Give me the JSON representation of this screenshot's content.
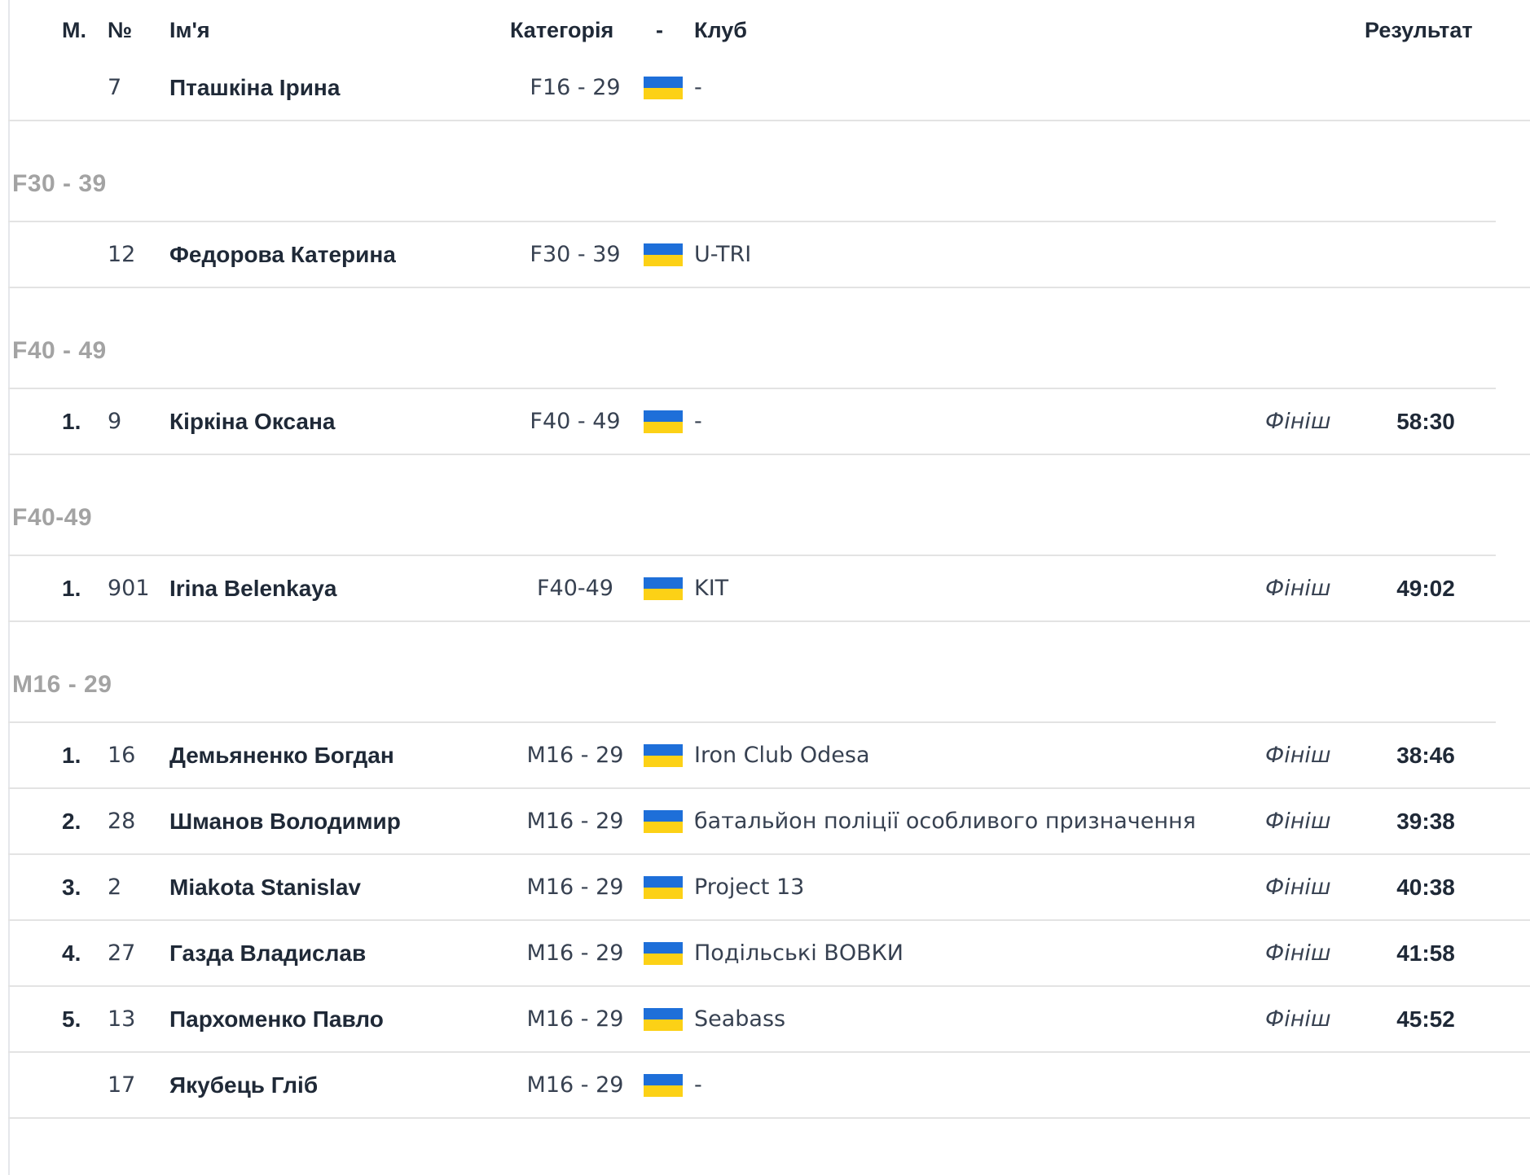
{
  "header": {
    "place": "М.",
    "number": "№",
    "name": "Ім'я",
    "category": "Категорія",
    "separator": "-",
    "club": "Клуб",
    "result": "Результат"
  },
  "colors": {
    "flag_blue": "#1e6fd9",
    "flag_yellow": "#fcd116",
    "group_title": "#a3a3a3"
  },
  "top_row": {
    "place": "",
    "number": "7",
    "name": "Пташкіна Ірина",
    "category": "F16 - 29",
    "flag": "ukraine-flag-icon",
    "club": "-",
    "status": "",
    "time": ""
  },
  "groups": [
    {
      "title": "F30 - 39",
      "rows": [
        {
          "place": "",
          "number": "12",
          "name": "Федорова Катерина",
          "category": "F30 - 39",
          "flag": "ukraine-flag-icon",
          "club": "U-TRI",
          "status": "",
          "time": ""
        }
      ]
    },
    {
      "title": "F40 - 49",
      "rows": [
        {
          "place": "1.",
          "number": "9",
          "name": "Кіркіна Оксана",
          "category": "F40 - 49",
          "flag": "ukraine-flag-icon",
          "club": "-",
          "status": "Фініш",
          "time": "58:30"
        }
      ]
    },
    {
      "title": "F40-49",
      "rows": [
        {
          "place": "1.",
          "number": "901",
          "name": "Irina Belenkaya",
          "category": "F40-49",
          "flag": "ukraine-flag-icon",
          "club": "KIT",
          "status": "Фініш",
          "time": "49:02"
        }
      ]
    },
    {
      "title": "M16 - 29",
      "rows": [
        {
          "place": "1.",
          "number": "16",
          "name": "Демьяненко Богдан",
          "category": "M16 - 29",
          "flag": "ukraine-flag-icon",
          "club": "Iron Club Odesa",
          "status": "Фініш",
          "time": "38:46"
        },
        {
          "place": "2.",
          "number": "28",
          "name": "Шманов Володимир",
          "category": "M16 - 29",
          "flag": "ukraine-flag-icon",
          "club": "батальйон поліції особливого призначення",
          "status": "Фініш",
          "time": "39:38"
        },
        {
          "place": "3.",
          "number": "2",
          "name": "Miakota Stanislav",
          "category": "M16 - 29",
          "flag": "ukraine-flag-icon",
          "club": "Project 13",
          "status": "Фініш",
          "time": "40:38"
        },
        {
          "place": "4.",
          "number": "27",
          "name": "Газда Владислав",
          "category": "M16 - 29",
          "flag": "ukraine-flag-icon",
          "club": "Подільські ВОВКИ",
          "status": "Фініш",
          "time": "41:58"
        },
        {
          "place": "5.",
          "number": "13",
          "name": "Пархоменко Павло",
          "category": "M16 - 29",
          "flag": "ukraine-flag-icon",
          "club": "Seabass",
          "status": "Фініш",
          "time": "45:52"
        },
        {
          "place": "",
          "number": "17",
          "name": "Якубець Гліб",
          "category": "M16 - 29",
          "flag": "ukraine-flag-icon",
          "club": "-",
          "status": "",
          "time": ""
        }
      ]
    }
  ]
}
